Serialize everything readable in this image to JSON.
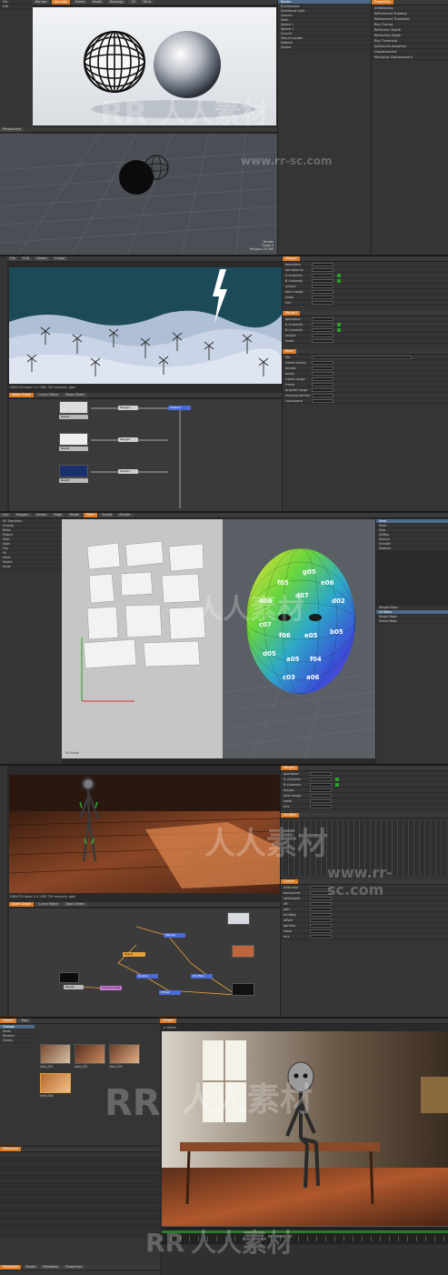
{
  "panel1": {
    "menu": [
      "File",
      "Edit",
      "View",
      "Select",
      "Item",
      "Texture",
      "Render",
      "Window",
      "Help"
    ],
    "tabs": [
      "Render",
      "Animate",
      "Scene",
      "Model",
      "Topology",
      "UV",
      "Paint",
      "Sculpt",
      "Setup"
    ],
    "active_tab": "Render",
    "viewport_label": "Perspective",
    "scene_tree": [
      "Render",
      "Environment",
      "Directional Light",
      "Camera",
      "Mesh",
      "Sphere 1",
      "Sphere 2",
      "Ground",
      "Texture Locator",
      "Material",
      "Shader"
    ],
    "properties_title": "Properties",
    "properties": [
      "Antialiasing",
      "Refinement Shading",
      "Refinement Threshold",
      "Ray Tracing",
      "Reflection Depth",
      "Refraction Depth",
      "Ray Threshold",
      "Indirect Illumination",
      "Displacement",
      "Micropoly Displacement"
    ],
    "info": [
      "Render",
      "Frame 0",
      "Polygons 15,360"
    ]
  },
  "panel2": {
    "tabs": [
      "File",
      "Edit",
      "Viewer",
      "Image",
      "Layer",
      "Render",
      "Cache",
      "Help"
    ],
    "viewer_status": "1280x720  bbox: 0 0 1280 720  channels: rgba",
    "node_tabs": [
      "Node Graph",
      "Curve Editor",
      "Dope Sheet"
    ],
    "nodes": [
      "Read1",
      "Read2",
      "Read3",
      "Merge1",
      "Merge2",
      "Grade1",
      "Viewer1"
    ],
    "props_title": "Merge1",
    "props": [
      "operation",
      "set bbox to",
      "A channels",
      "B channels",
      "output",
      "also merge",
      "mask",
      "mix"
    ],
    "props2": [
      "Merge2",
      "operation",
      "A channels",
      "B channels",
      "output",
      "mask"
    ],
    "read_props": [
      "Read",
      "file",
      "cache locally",
      "format",
      "proxy",
      "frame range",
      "frame",
      "original range",
      "missing frames",
      "colorspace"
    ]
  },
  "panel3": {
    "toolbar": [
      "Uvs",
      "Polygon",
      "Vertex",
      "Edge",
      "Model",
      "Paint",
      "Sculpt",
      "Render"
    ],
    "left_tools": [
      "UV Transform",
      "Unwrap",
      "Relax",
      "Project",
      "Pack",
      "Align",
      "Flip",
      "Fit",
      "Move",
      "Rotate",
      "Scale"
    ],
    "uv_label": "UV Editor",
    "uv_checker_labels": [
      "f05",
      "d06",
      "d07",
      "e06",
      "g05",
      "f06",
      "e05",
      "c07",
      "d05",
      "a05",
      "f04",
      "d02",
      "c03",
      "b05",
      "a06"
    ],
    "scene_list": [
      "Mesh",
      "Head",
      "Eyes",
      "UVMap",
      "Texture",
      "Checker",
      "Material"
    ],
    "right_props": [
      "Weight Maps",
      "UV Maps",
      "Morph Maps",
      "Vertex Maps"
    ]
  },
  "panel4": {
    "viewer_status": "1280x720  bbox: 0 0 1280 720  channels: rgba",
    "node_tabs": [
      "Node Graph",
      "Curve Editor",
      "Dope Sheet"
    ],
    "nodes": [
      "Read1",
      "Read2",
      "Merge1",
      "Grade1",
      "Shuffle1",
      "ColorCorrect1",
      "Write1"
    ],
    "props_title": "Merge1",
    "props": [
      "operation",
      "A channels",
      "B channels",
      "output",
      "also merge",
      "mask",
      "mix"
    ],
    "shuffle_title": "Shuffle1",
    "grade_title": "Grade1",
    "grade_props": [
      "channels",
      "blackpoint",
      "whitepoint",
      "lift",
      "gain",
      "multiply",
      "offset",
      "gamma",
      "mask",
      "mix"
    ]
  },
  "panel5": {
    "project_tab": "Project",
    "tabs": [
      "Project",
      "Tags"
    ],
    "bins": [
      "Footage",
      "Shots",
      "Renders",
      "Comps"
    ],
    "clip_labels": [
      "shot_001",
      "shot_002",
      "shot_003",
      "shot_004"
    ],
    "viewer_tab": "Viewer",
    "viewer_label": "A  Viewer",
    "timeline_tab": "Sequence",
    "bottom_tabs": [
      "Sequence",
      "Media",
      "Metadata",
      "Properties"
    ]
  },
  "watermark": {
    "text": "人人素材",
    "url": "www.rr-sc.com",
    "brand": "RR"
  },
  "colors": {
    "accent": "#d97c2a",
    "bg": "#2b2b2b",
    "panel": "#353535",
    "node_read": "#b9b9b9",
    "node_merge": "#4a6bd6",
    "node_grade": "#c97ad3",
    "node_viewer": "#e6a13a"
  }
}
